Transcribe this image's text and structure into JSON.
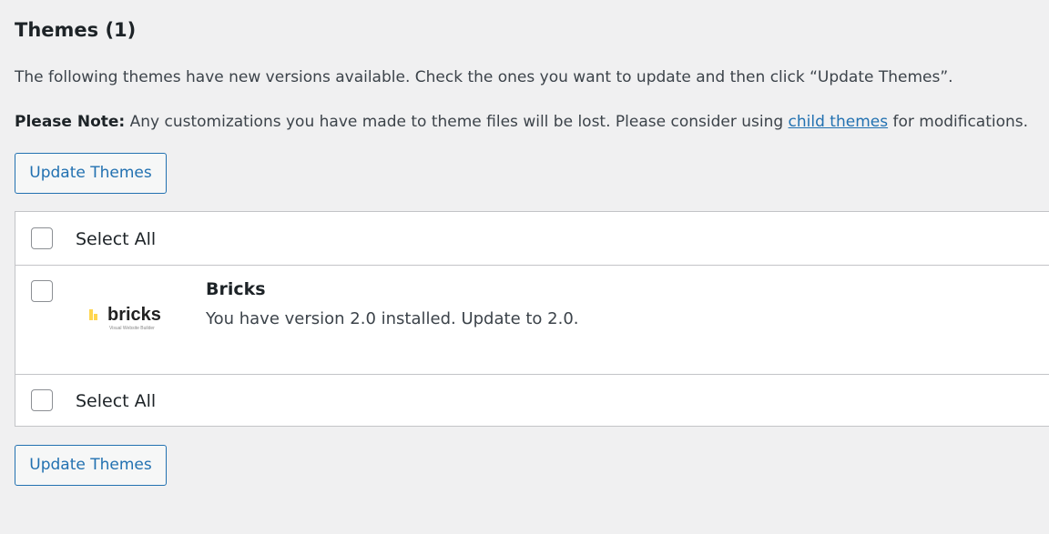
{
  "heading": "Themes (1)",
  "intro": "The following themes have new versions available. Check the ones you want to update and then click “Update Themes”.",
  "note": {
    "label": "Please Note:",
    "text_before": " Any customizations you have made to theme files will be lost. Please consider using ",
    "link": "child themes",
    "text_after": " for modifications."
  },
  "buttons": {
    "update_top": "Update Themes",
    "update_bottom": "Update Themes"
  },
  "table": {
    "select_all_top": "Select All",
    "select_all_bottom": "Select All",
    "themes": [
      {
        "name": "Bricks",
        "description": "You have version 2.0 installed. Update to 2.0.",
        "logo_text": "bricks",
        "logo_tagline": "Visual Website Builder",
        "logo_accent": "#ffd64f",
        "checked": false
      }
    ]
  },
  "colors": {
    "background": "#f0f0f1",
    "accent": "#2271b1",
    "text": "#1d2327",
    "border": "#c3c4c7"
  }
}
